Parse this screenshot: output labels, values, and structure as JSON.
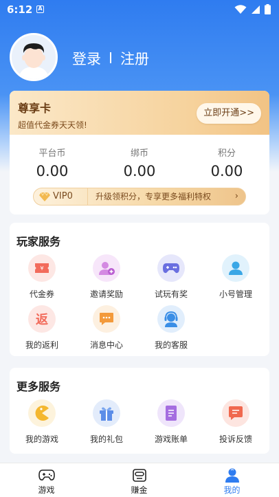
{
  "status": {
    "time": "6:12",
    "indicator": "A"
  },
  "user": {
    "login": "登录",
    "register": "注册"
  },
  "vip_card": {
    "title": "尊享卡",
    "subtitle": "超值代金券天天领!",
    "button": "立即开通>>",
    "stats": [
      {
        "label": "平台币",
        "value": "0.00"
      },
      {
        "label": "绑币",
        "value": "0.00"
      },
      {
        "label": "积分",
        "value": "0.00"
      }
    ],
    "level": "VIP0",
    "tip": "升级领积分，专享更多福利特权",
    "arrow": "›"
  },
  "player_services": {
    "title": "玩家服务",
    "items": [
      {
        "label": "代金券",
        "icon": "voucher-icon",
        "color": "#f26b5b",
        "bg": "#fde7e4"
      },
      {
        "label": "邀请奖励",
        "icon": "invite-icon",
        "color": "#c86ad9",
        "bg": "#f7e6fa"
      },
      {
        "label": "试玩有奖",
        "icon": "gamepad-icon",
        "color": "#6a6fe0",
        "bg": "#e6e7fb"
      },
      {
        "label": "小号管理",
        "icon": "account-icon",
        "color": "#3aa7e6",
        "bg": "#e1f2fc"
      },
      {
        "label": "我的返利",
        "icon": "rebate-icon",
        "color": "#f26b5b",
        "bg": "#fde7e4"
      },
      {
        "label": "消息中心",
        "icon": "message-icon",
        "color": "#f39a3b",
        "bg": "#fdf0e0"
      },
      {
        "label": "我的客服",
        "icon": "support-icon",
        "color": "#3a8ee6",
        "bg": "#e1eefc"
      }
    ]
  },
  "more_services": {
    "title": "更多服务",
    "items": [
      {
        "label": "我的游戏",
        "icon": "my-games-icon",
        "color": "#f4b72f",
        "bg": "#fdf3dc"
      },
      {
        "label": "我的礼包",
        "icon": "gift-icon",
        "color": "#5b8de8",
        "bg": "#e3ecfb"
      },
      {
        "label": "游戏账单",
        "icon": "bill-icon",
        "color": "#a56ee0",
        "bg": "#efe5fb"
      },
      {
        "label": "投诉反馈",
        "icon": "feedback-icon",
        "color": "#f0684e",
        "bg": "#fde5e0"
      }
    ]
  },
  "tabbar": [
    {
      "label": "游戏",
      "icon": "gamepad-tab-icon"
    },
    {
      "label": "赚金",
      "icon": "earn-tab-icon"
    },
    {
      "label": "我的",
      "icon": "profile-tab-icon",
      "active": true
    }
  ],
  "colors": {
    "primary": "#2f7cf0",
    "gold": "#6a3d15"
  }
}
